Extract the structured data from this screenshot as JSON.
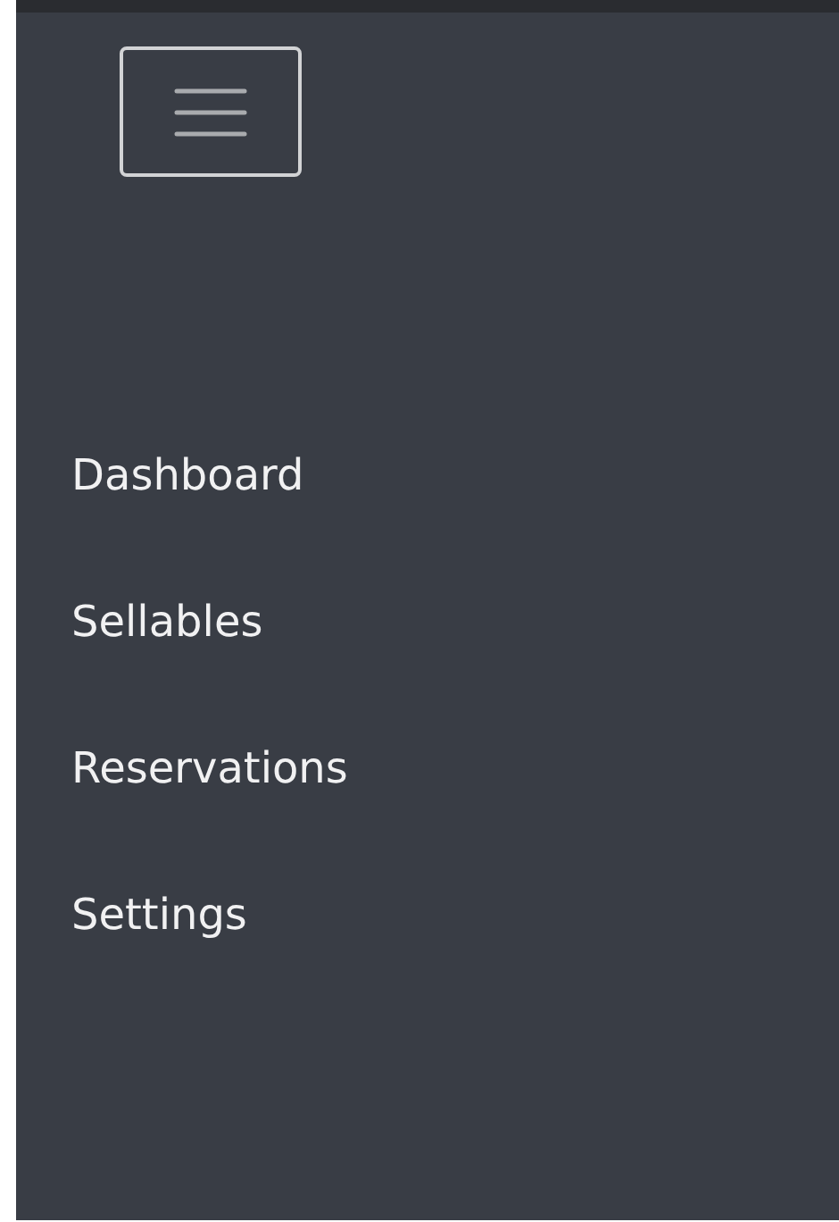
{
  "menu": {
    "items": [
      {
        "label": "Dashboard"
      },
      {
        "label": "Sellables"
      },
      {
        "label": "Reservations"
      },
      {
        "label": "Settings"
      }
    ]
  }
}
